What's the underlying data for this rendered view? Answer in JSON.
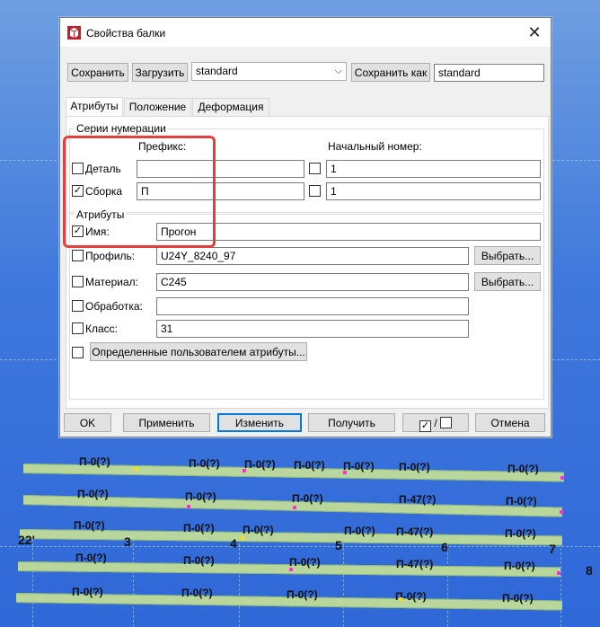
{
  "dialog": {
    "title": "Свойства балки",
    "close_glyph": "✕",
    "toolbar": {
      "save_label": "Сохранить",
      "load_label": "Загрузить",
      "preset_value": "standard",
      "save_as_label": "Сохранить как",
      "save_as_value": "standard"
    },
    "tabs": [
      "Атрибуты",
      "Положение",
      "Деформация"
    ],
    "numbering": {
      "group_title": "Серии нумерации",
      "prefix_header": "Префикс:",
      "start_header": "Начальный номер:",
      "rows": [
        {
          "label": "Деталь",
          "checked": false,
          "prefix": "",
          "start_checked": false,
          "start": "1"
        },
        {
          "label": "Сборка",
          "checked": true,
          "prefix": "П",
          "start_checked": false,
          "start": "1"
        }
      ]
    },
    "attributes": {
      "group_title": "Атрибуты",
      "name": {
        "label": "Имя:",
        "checked": true,
        "value": "Прогон"
      },
      "profile": {
        "label": "Профиль:",
        "checked": false,
        "value": "U24Y_8240_97",
        "button": "Выбрать..."
      },
      "material": {
        "label": "Материал:",
        "checked": false,
        "value": "C245",
        "button": "Выбрать..."
      },
      "finish": {
        "label": "Обработка:",
        "checked": false,
        "value": ""
      },
      "class": {
        "label": "Класс:",
        "checked": false,
        "value": "31"
      },
      "udf_button": "Определенные пользователем атрибуты..."
    },
    "footer": {
      "ok": "OK",
      "apply": "Применить",
      "modify": "Изменить",
      "get": "Получить",
      "toggle_sep": "/",
      "cancel": "Отмена"
    },
    "check_glyph": "✓"
  },
  "model": {
    "beam_labels": [
      [
        "П-0(?)",
        "П-0(?)",
        "П-0(?)",
        "П-0(?)",
        "П-0(?)",
        "П-0(?)",
        "П-0(?)"
      ],
      [
        "П-0(?)",
        "П-0(?)",
        "П-0(?)",
        "П-47(?)",
        "П-0(?)"
      ],
      [
        "П-0(?)",
        "П-0(?)",
        "П-0(?)",
        "П-0(?)",
        "П-47(?)",
        "П-0(?)"
      ],
      [
        "П-0(?)",
        "П-0(?)",
        "П-0(?)",
        "П-47(?)",
        "П-0(?)"
      ],
      [
        "П-0(?)",
        "П-0(?)",
        "П-0(?)",
        "П-0(?)",
        "П-0(?)"
      ]
    ],
    "grid_labels": [
      "22'",
      "3",
      "4",
      "5",
      "6",
      "7",
      "8"
    ]
  },
  "colors": {
    "highlight": "#e0413c",
    "beam": "#b9d79c",
    "background": "#3f78dc"
  }
}
